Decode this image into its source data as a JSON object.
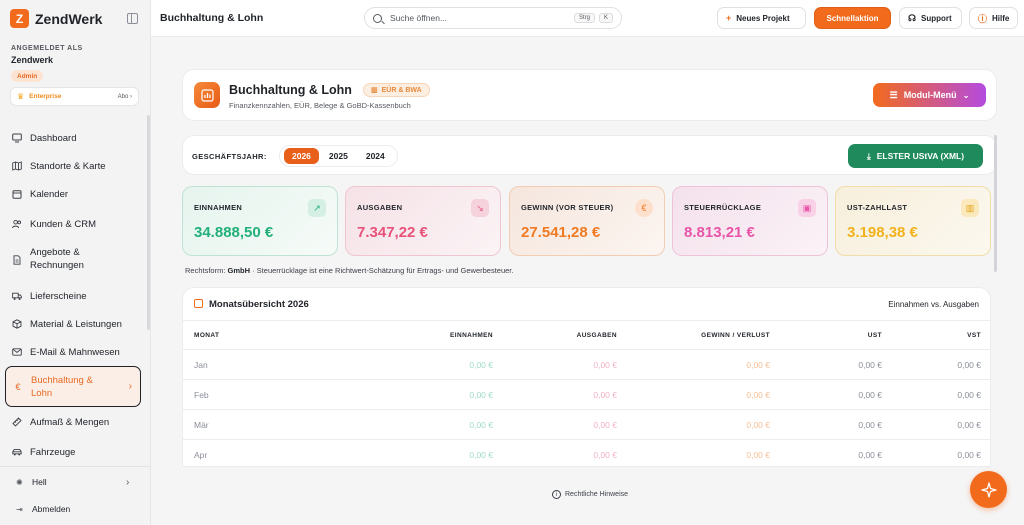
{
  "brand": {
    "name": "ZendWerk",
    "logo_letter": "Z"
  },
  "sidebar": {
    "logged_in_label": "ANGEMELDET ALS",
    "org_name": "Zendwerk",
    "role": "Admin",
    "plan": {
      "name": "Enterprise",
      "link": "Abo ›"
    },
    "items": [
      {
        "label": "Dashboard",
        "icon": "monitor-icon"
      },
      {
        "label": "Standorte & Karte",
        "icon": "map-icon"
      },
      {
        "label": "Kalender",
        "icon": "calendar-icon"
      },
      {
        "label": "Kunden & CRM",
        "icon": "users-icon"
      },
      {
        "label": "Angebote &",
        "label2": "Rechnungen",
        "icon": "document-icon"
      },
      {
        "label": "Lieferscheine",
        "icon": "truck-icon"
      },
      {
        "label": "Material & Leistungen",
        "icon": "package-icon"
      },
      {
        "label": "E-Mail & Mahnwesen",
        "icon": "mail-icon"
      },
      {
        "label": "Buchhaltung &",
        "label2": "Lohn",
        "icon": "euro-icon",
        "active": true
      },
      {
        "label": "Aufmaß & Mengen",
        "icon": "ruler-icon"
      },
      {
        "label": "Fahrzeuge",
        "icon": "car-icon"
      }
    ],
    "theme_label": "Hell",
    "logout_label": "Abmelden"
  },
  "topbar": {
    "title": "Buchhaltung & Lohn",
    "search_placeholder": "Suche öffnen...",
    "kbd1": "Strg",
    "kbd2": "K",
    "new_project": "Neues Projekt",
    "quick_action": "Schnellaktion",
    "support": "Support",
    "help": "Hilfe"
  },
  "module": {
    "title": "Buchhaltung & Lohn",
    "badge": "EÜR & BWA",
    "subtitle": "Finanzkennzahlen, EÜR, Belege & GoBD-Kassenbuch",
    "menu_label": "Modul-Menü"
  },
  "fiscal": {
    "label": "GESCHÄFTSJAHR:",
    "years": [
      "2026",
      "2025",
      "2024"
    ],
    "active": "2026",
    "elster_label": "ELSTER UStVA (XML)"
  },
  "kpis": [
    {
      "label": "EINNAHMEN",
      "value": "34.888,50 €",
      "color": "#22b07a",
      "icon": "trend-up-icon"
    },
    {
      "label": "AUSGABEN",
      "value": "7.347,22 €",
      "color": "#e8527a",
      "icon": "trend-down-icon"
    },
    {
      "label": "GEWINN (VOR STEUER)",
      "value": "27.541,28 €",
      "color": "#f07a22",
      "icon": "euro-icon"
    },
    {
      "label": "STEUERRÜCKLAGE",
      "value": "8.813,21 €",
      "color": "#e855a8",
      "icon": "piggy-icon"
    },
    {
      "label": "UST-ZAHLLAST",
      "value": "3.198,38 €",
      "color": "#f2b21d",
      "icon": "chart-icon"
    }
  ],
  "note": {
    "prefix": "Rechtsform: ",
    "form": "GmbH",
    "text": " · Steuerrücklage ist eine Richtwert-Schätzung für Ertrags- und Gewerbesteuer."
  },
  "table": {
    "title": "Monatsübersicht 2026",
    "right_label": "Einnahmen vs. Ausgaben",
    "headers": [
      "MONAT",
      "EINNAHMEN",
      "AUSGABEN",
      "GEWINN / VERLUST",
      "UST",
      "VST"
    ],
    "rows": [
      {
        "month": "Jan",
        "income": "0,00 €",
        "expense": "0,00 €",
        "profit": "0,00 €",
        "ust": "0,00 €",
        "vst": "0,00 €"
      },
      {
        "month": "Feb",
        "income": "0,00 €",
        "expense": "0,00 €",
        "profit": "0,00 €",
        "ust": "0,00 €",
        "vst": "0,00 €"
      },
      {
        "month": "Mär",
        "income": "0,00 €",
        "expense": "0,00 €",
        "profit": "0,00 €",
        "ust": "0,00 €",
        "vst": "0,00 €"
      },
      {
        "month": "Apr",
        "income": "0,00 €",
        "expense": "0,00 €",
        "profit": "0,00 €",
        "ust": "0,00 €",
        "vst": "0,00 €"
      }
    ]
  },
  "footer": {
    "legal_link": "Rechtliche Hinweise"
  },
  "colors": {
    "accent": "#f26b1d",
    "green": "#1f8a5b",
    "purple": "#b44be0"
  }
}
